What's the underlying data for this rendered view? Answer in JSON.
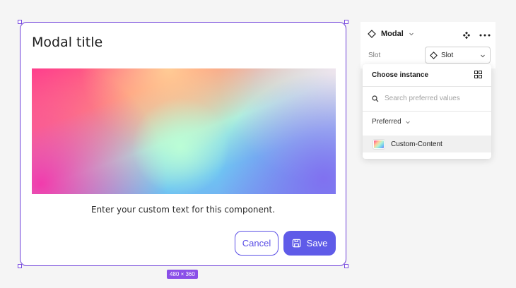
{
  "modal": {
    "title": "Modal title",
    "body_text": "Enter your custom text for this component.",
    "cancel_label": "Cancel",
    "save_label": "Save"
  },
  "selection": {
    "size_label": "480 × 360"
  },
  "panel": {
    "component_name": "Modal",
    "slot_label": "Slot",
    "slot_value": "Slot"
  },
  "popover": {
    "title": "Choose instance",
    "search_placeholder": "Search preferred values",
    "section_label": "Preferred",
    "items": [
      {
        "label": "Custom-Content"
      }
    ]
  },
  "colors": {
    "accent": "#5f5be8",
    "selection": "#6d3fd8",
    "size_badge": "#8a4fe8"
  },
  "icons": {
    "save": "save-icon",
    "component": "component-diamond-icon",
    "instance": "instance-diamond-icon",
    "more": "more-icon",
    "grid": "grid-icon",
    "search": "search-icon",
    "chevron": "chevron-down-icon"
  }
}
